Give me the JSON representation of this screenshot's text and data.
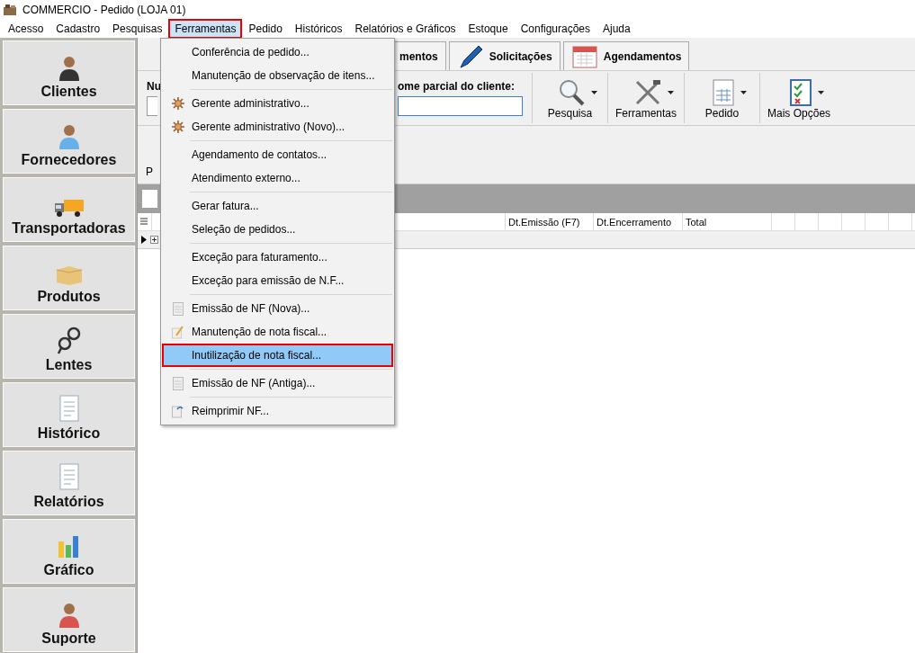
{
  "window": {
    "title": "COMMERCIO - Pedido (LOJA 01)"
  },
  "menubar": [
    {
      "label": "Acesso",
      "open": false
    },
    {
      "label": "Cadastro",
      "open": false
    },
    {
      "label": "Pesquisas",
      "open": false
    },
    {
      "label": "Ferramentas",
      "open": true
    },
    {
      "label": "Pedido",
      "open": false
    },
    {
      "label": "Históricos",
      "open": false
    },
    {
      "label": "Relatórios e Gráficos",
      "open": false
    },
    {
      "label": "Estoque",
      "open": false
    },
    {
      "label": "Configurações",
      "open": false
    },
    {
      "label": "Ajuda",
      "open": false
    }
  ],
  "menu": [
    {
      "kind": "item",
      "label": "Conferência de pedido...",
      "selected": false
    },
    {
      "kind": "item",
      "label": "Manutenção de observação de itens...",
      "selected": false
    },
    {
      "kind": "separator"
    },
    {
      "kind": "item",
      "label": "Gerente administrativo...",
      "selected": false
    },
    {
      "kind": "item",
      "label": "Gerente administrativo (Novo)...",
      "selected": false
    },
    {
      "kind": "separator"
    },
    {
      "kind": "item",
      "label": "Agendamento de contatos...",
      "selected": false
    },
    {
      "kind": "item",
      "label": "Atendimento externo...",
      "selected": false
    },
    {
      "kind": "separator"
    },
    {
      "kind": "item",
      "label": "Gerar fatura...",
      "selected": false
    },
    {
      "kind": "item",
      "label": "Seleção de pedidos...",
      "selected": false
    },
    {
      "kind": "separator"
    },
    {
      "kind": "item",
      "label": "Exceção para faturamento...",
      "selected": false
    },
    {
      "kind": "item",
      "label": "Exceção para emissão de N.F...",
      "selected": false
    },
    {
      "kind": "separator"
    },
    {
      "kind": "item",
      "label": "Emissão de NF (Nova)...",
      "selected": false
    },
    {
      "kind": "item",
      "label": "Manutenção de nota fiscal...",
      "selected": false
    },
    {
      "kind": "item",
      "label": "Inutilização de nota fiscal...",
      "selected": true
    },
    {
      "kind": "separator"
    },
    {
      "kind": "item",
      "label": "Emissão de NF (Antiga)...",
      "selected": false
    },
    {
      "kind": "separator"
    },
    {
      "kind": "item",
      "label": "Reimprimir NF...",
      "selected": false
    }
  ],
  "sidebar": [
    "Clientes",
    "Fornecedores",
    "Transportadoras",
    "Produtos",
    "Lentes",
    "Histórico",
    "Relatórios",
    "Gráfico",
    "Suporte"
  ],
  "tabs": [
    "mentos",
    "Solicitações",
    "Agendamentos"
  ],
  "search": {
    "number_label": "Nu",
    "name_label": "ome parcial do cliente:"
  },
  "toolbar": [
    "Pesquisa",
    "Ferramentas",
    "Pedido",
    "Mais Opções"
  ],
  "second_bar": {
    "label": "P"
  },
  "table": {
    "columns": [
      "Dt.Emissão (F7)",
      "Dt.Encerramento",
      "Total"
    ]
  }
}
